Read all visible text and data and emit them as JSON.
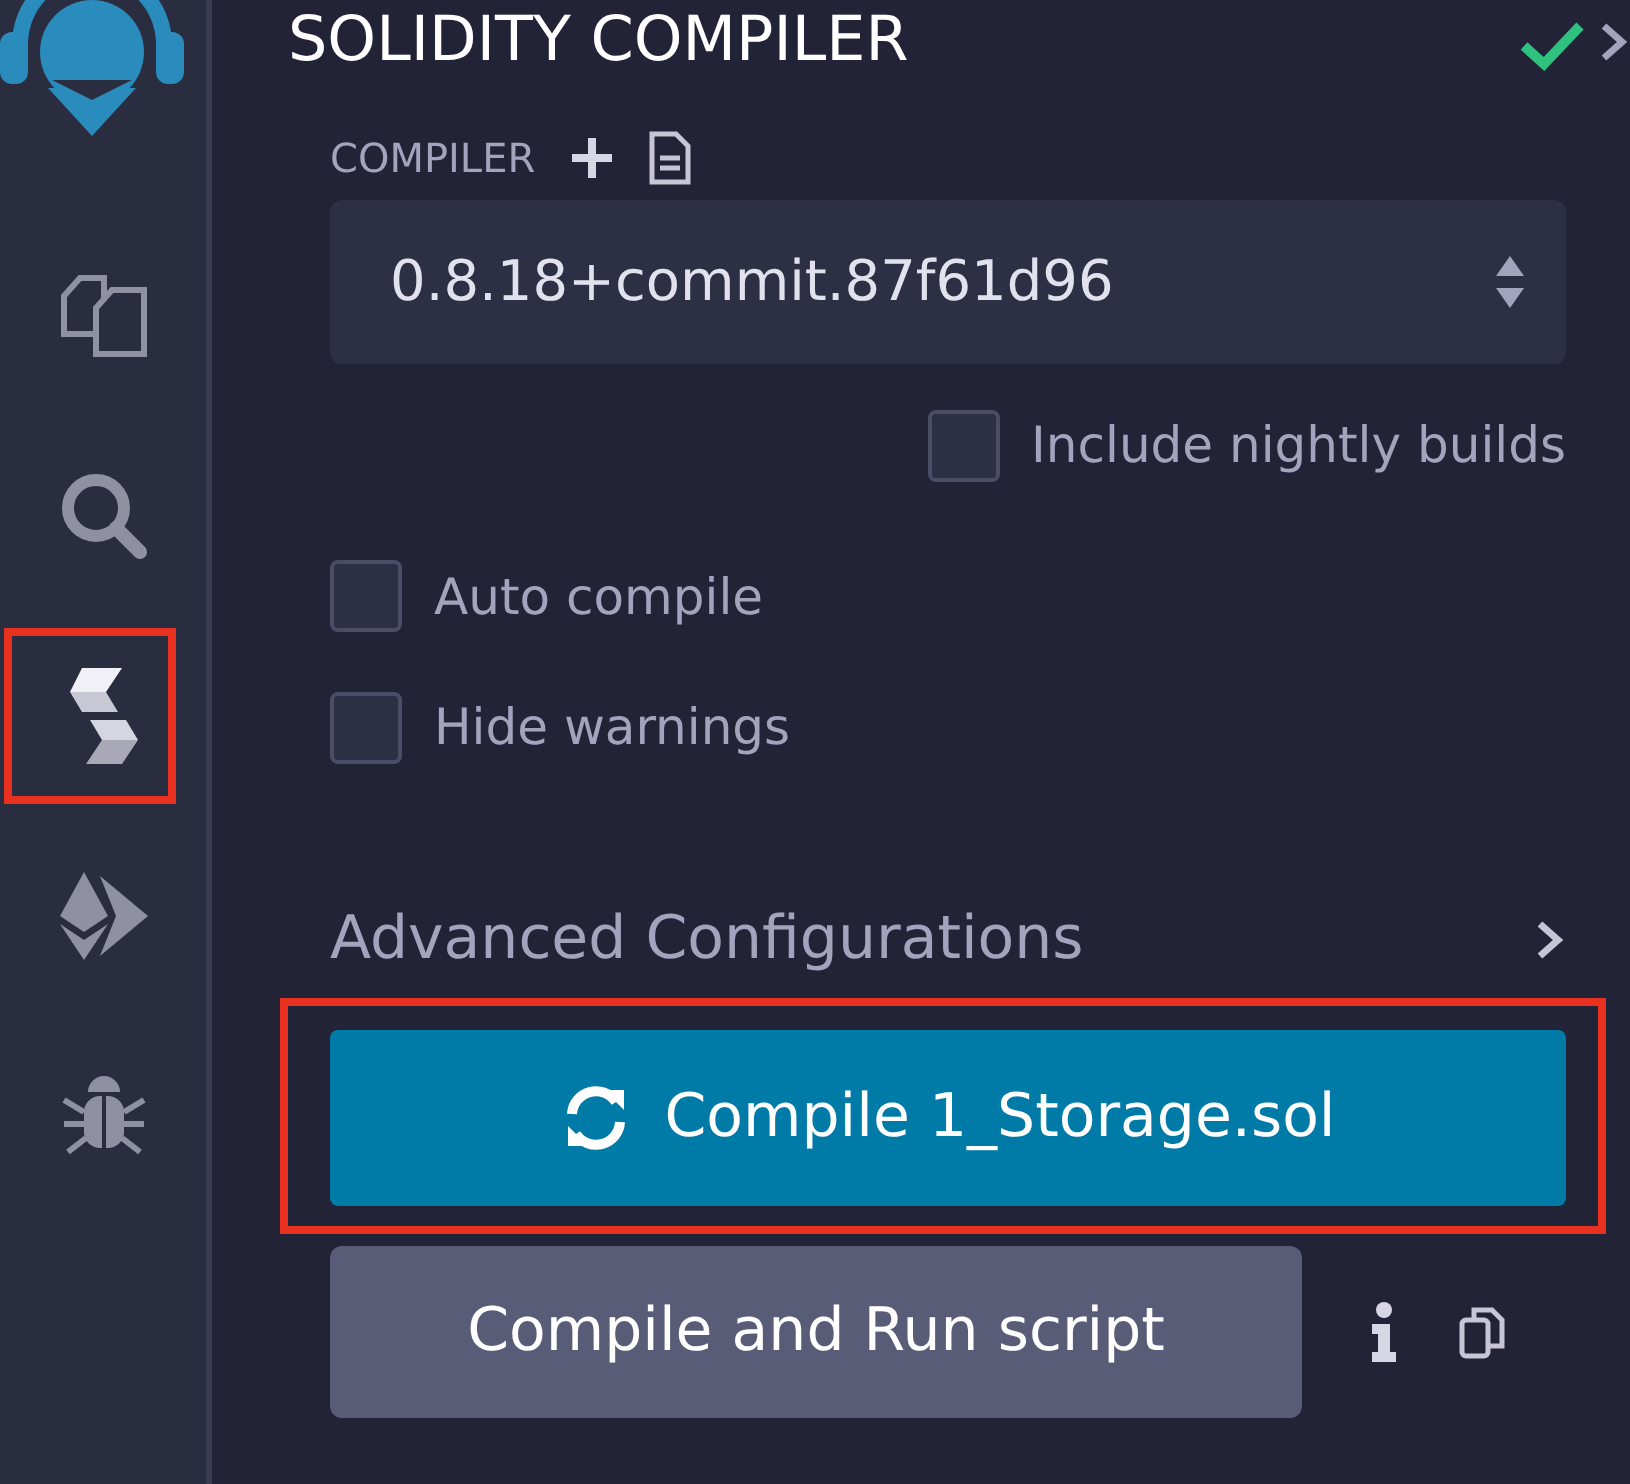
{
  "sidebar": {
    "items": [
      {
        "kind": "files",
        "highlighted": false
      },
      {
        "kind": "search",
        "highlighted": false
      },
      {
        "kind": "solidity",
        "highlighted": true
      },
      {
        "kind": "deploy",
        "highlighted": false
      },
      {
        "kind": "debug",
        "highlighted": false
      }
    ]
  },
  "panel": {
    "title": "SOLIDITY COMPILER",
    "compiler_label": "COMPILER",
    "compiler_version": "0.8.18+commit.87f61d96",
    "options": [
      {
        "label": "Include nightly builds",
        "checked": false
      },
      {
        "label": "Auto compile",
        "checked": false
      },
      {
        "label": "Hide warnings",
        "checked": false
      }
    ],
    "advanced": "Advanced Configurations",
    "compile_button": {
      "label": "Compile 1_Storage.sol",
      "highlighted": true
    },
    "run_button": "Compile and Run script"
  }
}
